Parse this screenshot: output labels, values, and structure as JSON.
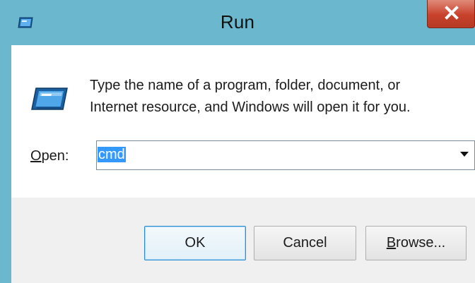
{
  "window": {
    "title": "Run",
    "accent_color": "#6ab7ce",
    "close_color": "#c8412b"
  },
  "icons": {
    "title_icon": "run-icon",
    "main_icon": "run-icon",
    "close_icon": "close-icon",
    "dropdown_icon": "chevron-down-icon"
  },
  "description": {
    "line1": "Type the name of a program, folder, document, or",
    "line2": "Internet resource, and Windows will open it for you."
  },
  "open_field": {
    "label_access_key": "O",
    "label_rest": "pen:",
    "value": "cmd"
  },
  "buttons": {
    "ok": "OK",
    "cancel": "Cancel",
    "browse_access_key": "B",
    "browse_rest": "rowse..."
  }
}
